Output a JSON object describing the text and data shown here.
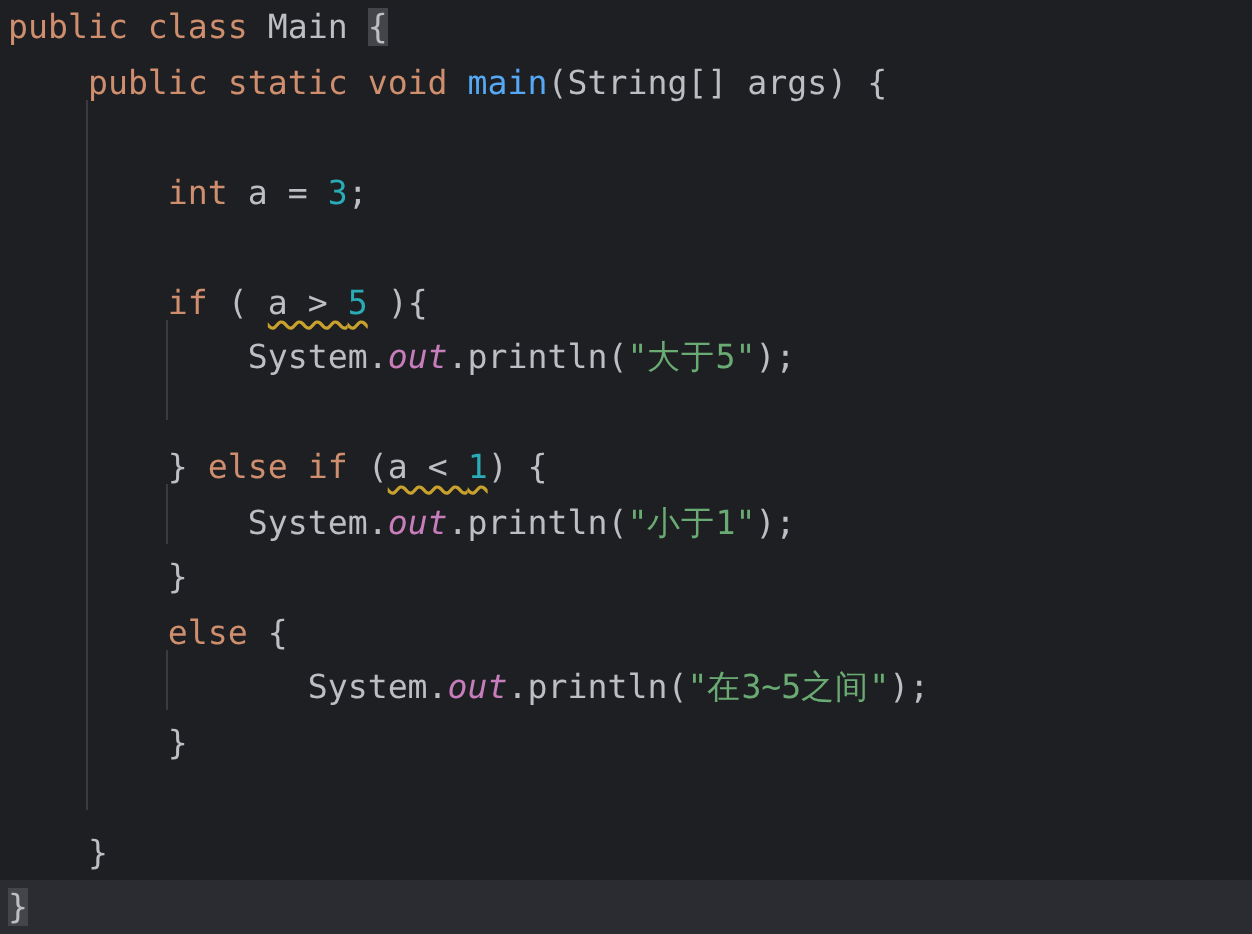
{
  "editor": {
    "lines": [
      {
        "current": false,
        "tokens": [
          {
            "kind": "keyword",
            "text": "public class "
          },
          {
            "kind": "plain",
            "text": "Main "
          },
          {
            "kind": "brace_match",
            "text": "{"
          }
        ]
      },
      {
        "current": false,
        "tokens": [
          {
            "kind": "keyword",
            "text": "    public static void "
          },
          {
            "kind": "method",
            "text": "main"
          },
          {
            "kind": "plain",
            "text": "(String[] args) {"
          }
        ]
      },
      {
        "kind": "blank"
      },
      {
        "current": false,
        "tokens": [
          {
            "kind": "keyword",
            "text": "        int "
          },
          {
            "kind": "plain",
            "text": "a = "
          },
          {
            "kind": "number",
            "text": "3"
          },
          {
            "kind": "plain",
            "text": ";"
          }
        ]
      },
      {
        "kind": "blank"
      },
      {
        "current": false,
        "tokens": [
          {
            "kind": "keyword",
            "text": "        if "
          },
          {
            "kind": "plain",
            "text": "( "
          },
          {
            "kind": "warning",
            "parts": [
              {
                "kind": "plain",
                "text": "a > "
              },
              {
                "kind": "number",
                "text": "5"
              }
            ]
          },
          {
            "kind": "plain",
            "text": " ){"
          }
        ]
      },
      {
        "current": false,
        "tokens": [
          {
            "kind": "plain",
            "text": "            System."
          },
          {
            "kind": "field",
            "text": "out"
          },
          {
            "kind": "plain",
            "text": ".println("
          },
          {
            "kind": "string",
            "text": "\"大于5\""
          },
          {
            "kind": "plain",
            "text": ");"
          }
        ]
      },
      {
        "kind": "blank"
      },
      {
        "current": false,
        "tokens": [
          {
            "kind": "plain",
            "text": "        } "
          },
          {
            "kind": "keyword",
            "text": "else if "
          },
          {
            "kind": "plain",
            "text": "("
          },
          {
            "kind": "warning",
            "parts": [
              {
                "kind": "plain",
                "text": "a < "
              },
              {
                "kind": "number",
                "text": "1"
              }
            ]
          },
          {
            "kind": "plain",
            "text": ") {"
          }
        ]
      },
      {
        "current": false,
        "tokens": [
          {
            "kind": "plain",
            "text": "            System."
          },
          {
            "kind": "field",
            "text": "out"
          },
          {
            "kind": "plain",
            "text": ".println("
          },
          {
            "kind": "string",
            "text": "\"小于1\""
          },
          {
            "kind": "plain",
            "text": ");"
          }
        ]
      },
      {
        "current": false,
        "tokens": [
          {
            "kind": "plain",
            "text": "        }"
          }
        ]
      },
      {
        "current": false,
        "tokens": [
          {
            "kind": "keyword",
            "text": "        else "
          },
          {
            "kind": "plain",
            "text": "{"
          }
        ]
      },
      {
        "current": false,
        "tokens": [
          {
            "kind": "plain",
            "text": "               System."
          },
          {
            "kind": "field",
            "text": "out"
          },
          {
            "kind": "plain",
            "text": ".println("
          },
          {
            "kind": "string",
            "text": "\"在3~5之间\""
          },
          {
            "kind": "plain",
            "text": ");"
          }
        ]
      },
      {
        "current": false,
        "tokens": [
          {
            "kind": "plain",
            "text": "        }"
          }
        ]
      },
      {
        "kind": "blank"
      },
      {
        "current": false,
        "tokens": [
          {
            "kind": "plain",
            "text": "    }"
          }
        ]
      },
      {
        "current": true,
        "tokens": [
          {
            "kind": "brace_match",
            "text": "}"
          }
        ]
      }
    ]
  }
}
